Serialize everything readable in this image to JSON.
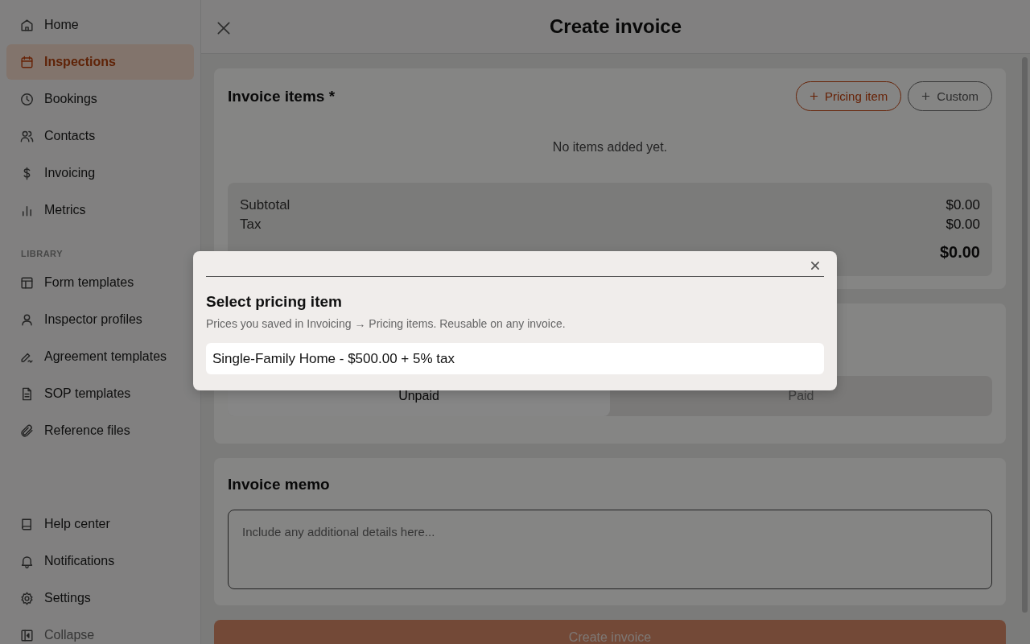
{
  "sidebar": {
    "main_items": [
      {
        "label": "Home",
        "selected": false
      },
      {
        "label": "Inspections",
        "selected": true
      },
      {
        "label": "Bookings",
        "selected": false
      },
      {
        "label": "Contacts",
        "selected": false
      },
      {
        "label": "Invoicing",
        "selected": false
      },
      {
        "label": "Metrics",
        "selected": false
      }
    ],
    "library_heading": "LIBRARY",
    "library_items": [
      {
        "label": "Form templates",
        "selected": false
      },
      {
        "label": "Inspector profiles",
        "selected": false
      },
      {
        "label": "Agreement templates",
        "selected": false
      },
      {
        "label": "SOP templates",
        "selected": false
      },
      {
        "label": "Reference files",
        "selected": false
      }
    ],
    "bottom_items": [
      {
        "label": "Help center",
        "muted": false
      },
      {
        "label": "Notifications",
        "muted": false
      },
      {
        "label": "Settings",
        "muted": false
      },
      {
        "label": "Collapse",
        "muted": true
      }
    ]
  },
  "header": {
    "title": "Create invoice"
  },
  "invoice_items": {
    "heading": "Invoice items *",
    "buttons": [
      {
        "label": "Pricing item",
        "kind": "primary"
      },
      {
        "label": "Custom",
        "kind": "secondary"
      }
    ],
    "empty_text": "No items added yet.",
    "totals": [
      {
        "label": "Subtotal",
        "value": "$0.00",
        "kind": "line"
      },
      {
        "label": "Tax",
        "value": "$0.00",
        "kind": "line"
      },
      {
        "value": "$0.00",
        "kind": "total"
      }
    ]
  },
  "payment_status": {
    "options": [
      {
        "label": "Unpaid",
        "selected": true
      },
      {
        "label": "Paid",
        "selected": false
      }
    ]
  },
  "memo": {
    "heading": "Invoice memo",
    "placeholder": "Include any additional details here..."
  },
  "submit": {
    "label": "Create invoice",
    "disabled": true
  },
  "dialog": {
    "title": "Select pricing item",
    "subtitle": "Prices you saved in Invoicing → Pricing items. Reusable on any invoice.",
    "items": [
      "Single-Family Home - $500.00 + 5% tax"
    ]
  }
}
